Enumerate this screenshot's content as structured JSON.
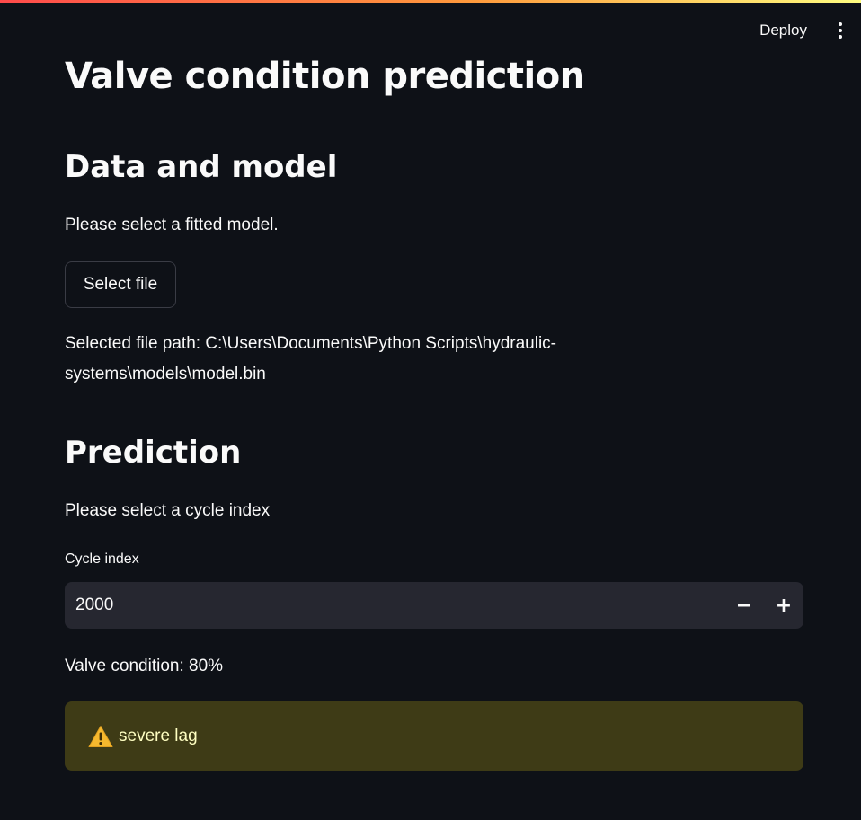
{
  "header": {
    "deploy_label": "Deploy",
    "menu_icon": "vertical-dots-icon"
  },
  "main": {
    "title": "Valve condition prediction",
    "data_section": {
      "heading": "Data and model",
      "instruction": "Please select a fitted model.",
      "select_button_label": "Select file",
      "selected_path_line1": "Selected file path: C:\\Users\\Documents\\Python Scripts\\hydraulic-",
      "selected_path_line2": "systems\\models\\model.bin"
    },
    "prediction_section": {
      "heading": "Prediction",
      "instruction": "Please select a cycle index",
      "cycle_label": "Cycle index",
      "cycle_value": "2000",
      "decrement_label": "−",
      "increment_label": "+",
      "result": "Valve condition: 80%",
      "warning_icon": "warning-triangle-icon",
      "warning_text": "severe lag"
    }
  },
  "colors": {
    "background": "#0e1117",
    "input_background": "#262730",
    "warning_background": "#3e3b16",
    "warning_text": "#ffffc2",
    "accent_gradient_start": "#ff4b4b",
    "accent_gradient_end": "#fffd80"
  }
}
